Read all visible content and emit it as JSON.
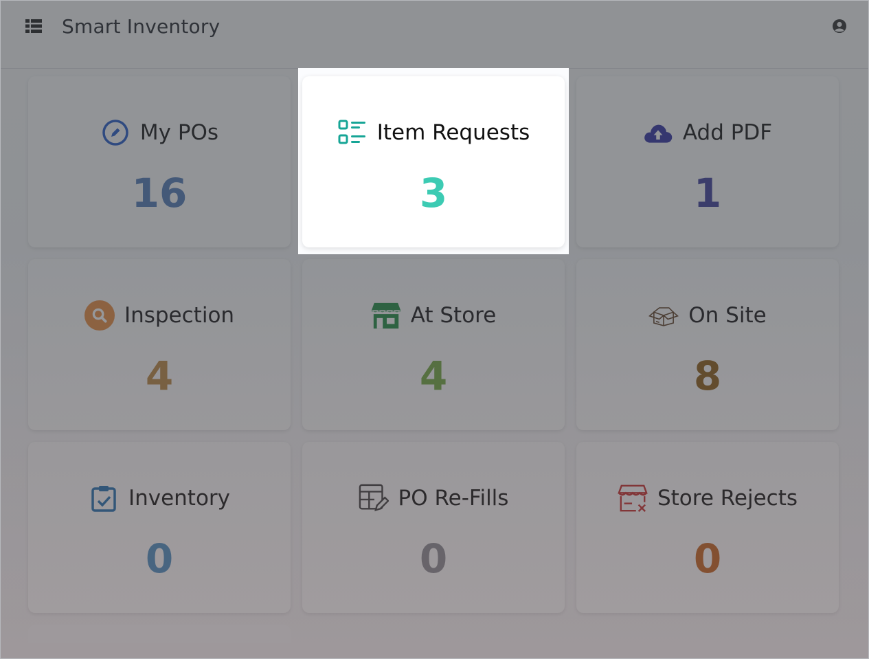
{
  "app": {
    "title": "Smart Inventory"
  },
  "icons": {
    "menu": "list-menu-icon",
    "user": "user-circle-icon"
  },
  "cards": [
    {
      "label": "My POs",
      "count": "16",
      "icon": "pen-circle-icon",
      "color": "#3b5fb0"
    },
    {
      "label": "Item Requests",
      "count": "3",
      "icon": "checklist-icon",
      "color": "#3cc3ad"
    },
    {
      "label": "Add PDF",
      "count": "1",
      "icon": "cloud-upload-icon",
      "color": "#3a3a9a"
    },
    {
      "label": "Inspection",
      "count": "4",
      "icon": "search-circle-icon",
      "color": "#b8843e"
    },
    {
      "label": "At Store",
      "count": "4",
      "icon": "store-icon",
      "color": "#6fa63c"
    },
    {
      "label": "On Site",
      "count": "8",
      "icon": "open-box-icon",
      "color": "#8a5a12"
    },
    {
      "label": "Inventory",
      "count": "0",
      "icon": "clipboard-check-icon",
      "color": "#4a8cc0"
    },
    {
      "label": "PO Re-Fills",
      "count": "0",
      "icon": "table-edit-icon",
      "color": "#8a8a92"
    },
    {
      "label": "Store Rejects",
      "count": "0",
      "icon": "store-reject-icon",
      "color": "#c2601c"
    }
  ],
  "highlight_index": 1
}
